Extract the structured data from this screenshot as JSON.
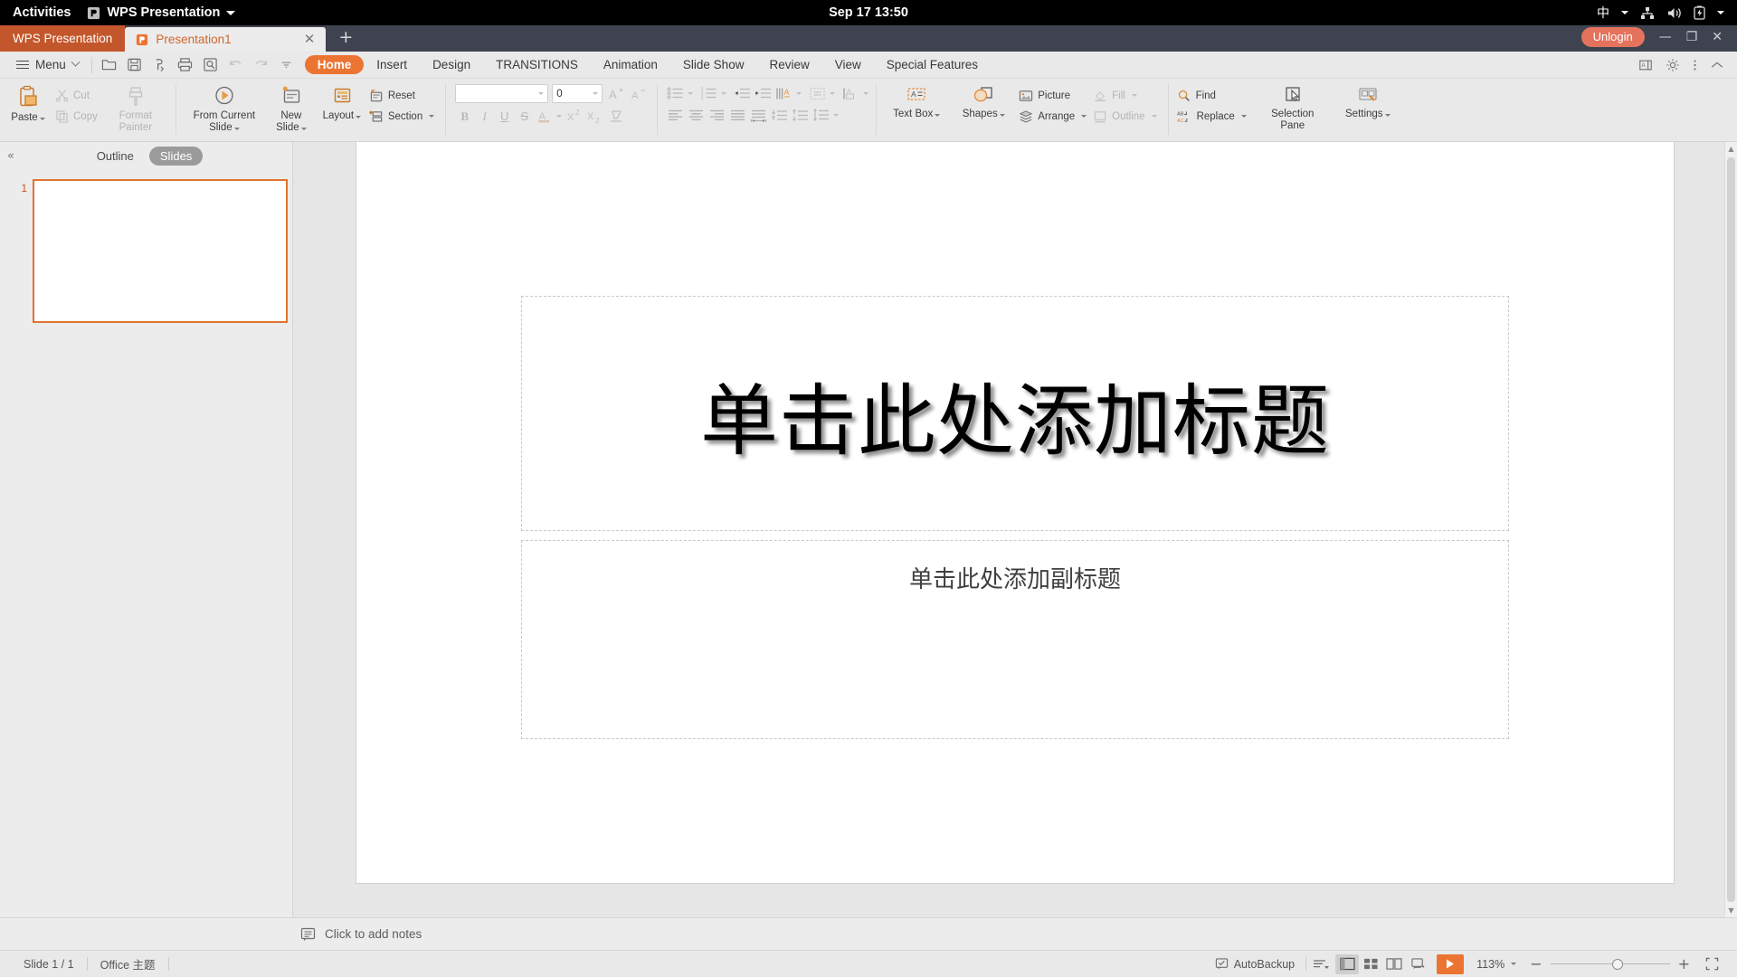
{
  "gnome": {
    "activities": "Activities",
    "app_name": "WPS Presentation",
    "clock": "Sep 17 13:50",
    "ime": "中",
    "icons": [
      "wps-app-icon",
      "network-icon",
      "volume-icon",
      "battery-icon",
      "system-menu-caret-icon"
    ]
  },
  "tabstrip": {
    "app_tab": "WPS Presentation",
    "doc_tab": "Presentation1",
    "close_glyph": "✕",
    "new_tab_glyph": "+",
    "unlogin": "Unlogin",
    "minimize_glyph": "—",
    "restore_glyph": "❐",
    "close_window_glyph": "✕"
  },
  "menubar": {
    "menu_label": "Menu",
    "quick_access": [
      "open-icon",
      "save-icon",
      "export-pdf-icon",
      "print-icon",
      "print-preview-icon",
      "undo-icon",
      "redo-icon",
      "customize-qat-icon"
    ],
    "tabs": [
      {
        "label": "Home",
        "active": true
      },
      {
        "label": "Insert",
        "active": false
      },
      {
        "label": "Design",
        "active": false
      },
      {
        "label": "TRANSITIONS",
        "active": false
      },
      {
        "label": "Animation",
        "active": false
      },
      {
        "label": "Slide Show",
        "active": false
      },
      {
        "label": "Review",
        "active": false
      },
      {
        "label": "View",
        "active": false
      },
      {
        "label": "Special Features",
        "active": false
      }
    ],
    "right_icons": [
      "document-mode-icon",
      "gear-icon",
      "more-options-icon",
      "collapse-ribbon-icon"
    ]
  },
  "ribbon": {
    "paste": "Paste",
    "cut": "Cut",
    "copy": "Copy",
    "format_painter_l1": "Format",
    "format_painter_l2": "Painter",
    "from_current_slide_l1": "From Current",
    "from_current_slide_l2": "Slide",
    "new_slide_l1": "New",
    "new_slide_l2": "Slide",
    "layout": "Layout",
    "reset": "Reset",
    "section": "Section",
    "font_name": "",
    "font_name_placeholder": "",
    "font_size": "0",
    "grow_font": "A",
    "shrink_font": "A",
    "bold": "B",
    "italic": "I",
    "underline": "U",
    "strikethrough": "S",
    "font_color": "A",
    "superscript": "X",
    "subscript": "X",
    "clear_formatting": "clear-format-icon",
    "text_box": "Text Box",
    "shapes": "Shapes",
    "picture": "Picture",
    "arrange": "Arrange",
    "fill": "Fill",
    "outline": "Outline",
    "find": "Find",
    "replace": "Replace",
    "selection_pane_l1": "Selection",
    "selection_pane_l2": "Pane",
    "settings": "Settings"
  },
  "slide_panel": {
    "collapse_glyph": "«",
    "tab_outline": "Outline",
    "tab_slides": "Slides",
    "active_tab": "Slides",
    "thumbnails": [
      {
        "number": "1"
      }
    ]
  },
  "slide": {
    "title_placeholder": "单击此处添加标题",
    "subtitle_placeholder": "单击此处添加副标题"
  },
  "notes": {
    "placeholder": "Click to add notes",
    "icon": "notes-icon"
  },
  "statusbar": {
    "slide_count": "Slide 1 / 1",
    "theme": "Office 主题",
    "autobackup": "AutoBackup",
    "zoom_level": "113%",
    "zoom_minus": "−",
    "zoom_plus": "+",
    "view_buttons": [
      "normal-view-icon",
      "slide-sorter-icon",
      "reading-view-icon",
      "notes-view-icon"
    ],
    "play_icon": "play-slideshow-icon",
    "fit_icon": "fit-to-window-icon"
  },
  "colors": {
    "accent_orange": "#ec7433",
    "tab_app_orange": "#c3572b",
    "unlogin_red": "#e4725c",
    "tabstrip_dark": "#3f4350",
    "ribbon_bg": "#e9e9e9",
    "stage_bg": "#e6e6e6"
  }
}
